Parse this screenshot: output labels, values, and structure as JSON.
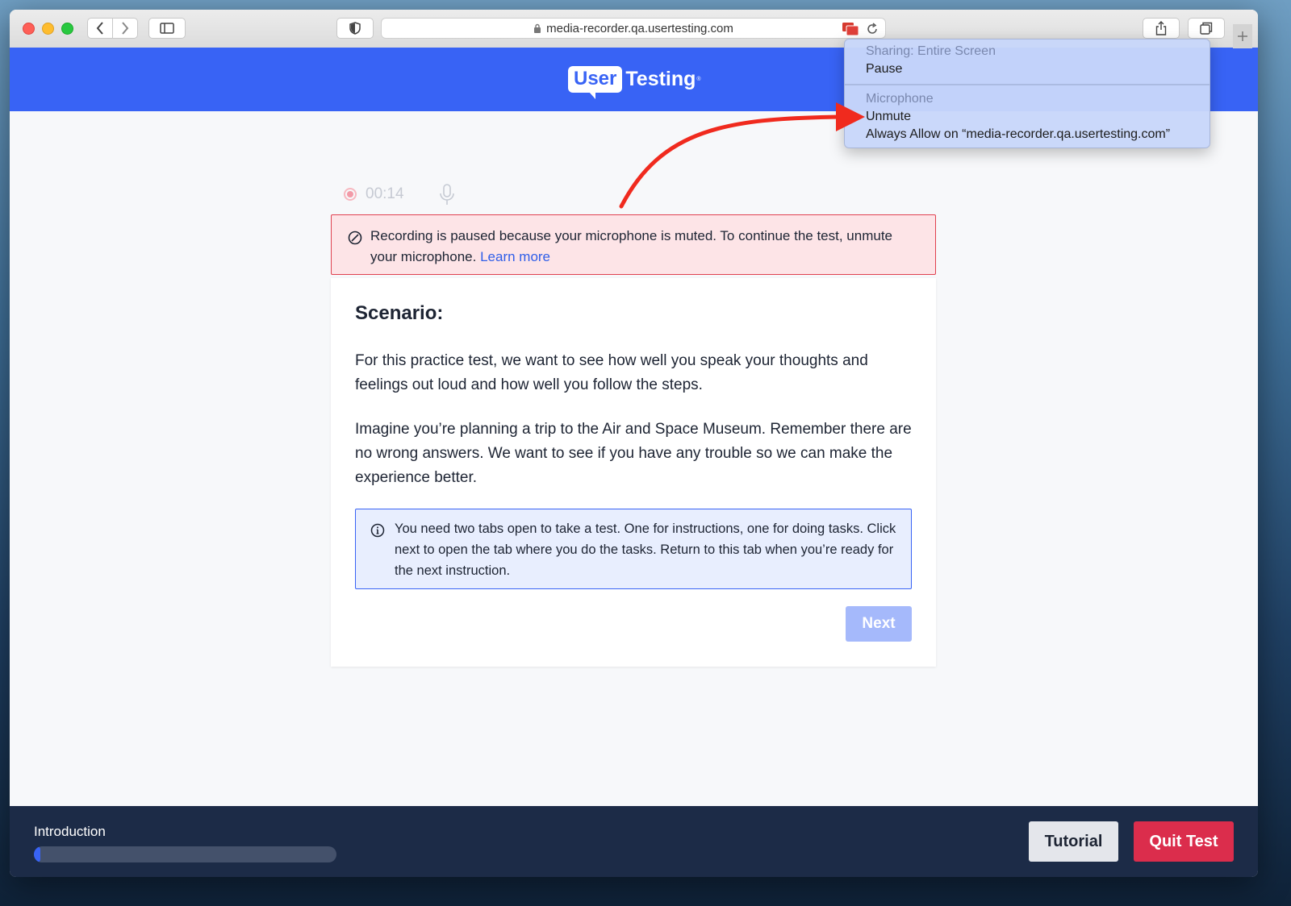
{
  "browser": {
    "url": "media-recorder.qa.usertesting.com",
    "icons": {
      "back": "chevron-left-icon",
      "forward": "chevron-right-icon",
      "sidebar": "sidebar-icon",
      "shield": "shield-icon",
      "screen_share": "screen-share-icon",
      "reload": "reload-icon",
      "share": "share-icon",
      "tabs": "tabs-icon",
      "new_tab": "plus-icon"
    }
  },
  "header": {
    "logo_user": "User",
    "logo_testing": "Testing",
    "logo_tm": "®"
  },
  "recording": {
    "time": "00:14"
  },
  "alert": {
    "text": "Recording is paused because your microphone is muted. To continue the test, unmute your microphone.",
    "link": "Learn more"
  },
  "card": {
    "title": "Scenario:",
    "paragraph1": "For this practice test, we want to see how well you speak your thoughts and feelings out loud and how well you follow the steps.",
    "paragraph2": "Imagine you’re planning a trip to the Air and Space Museum. Remember there are no wrong answers. We want to see if you have any trouble so we can make the experience better.",
    "info": "You need two tabs open to take a test. One for instructions, one for doing tasks. Click next to open the tab where you do the tasks. Return to this tab when you’re ready for the next instruction.",
    "next_label": "Next"
  },
  "footer": {
    "section_label": "Introduction",
    "progress": 0.02,
    "tutorial_label": "Tutorial",
    "quit_label": "Quit Test"
  },
  "popup": {
    "sharing_header": "Sharing: Entire Screen",
    "pause_label": "Pause",
    "mic_header": "Microphone",
    "unmute_label": "Unmute",
    "always_allow_label": "Always Allow on “media-recorder.qa.usertesting.com”"
  },
  "colors": {
    "brand_blue": "#3863f5",
    "alert_red": "#e0404f",
    "quit_red": "#db2d4c",
    "footer_navy": "#1c2b47",
    "annotation_arrow": "#f02a1e"
  }
}
